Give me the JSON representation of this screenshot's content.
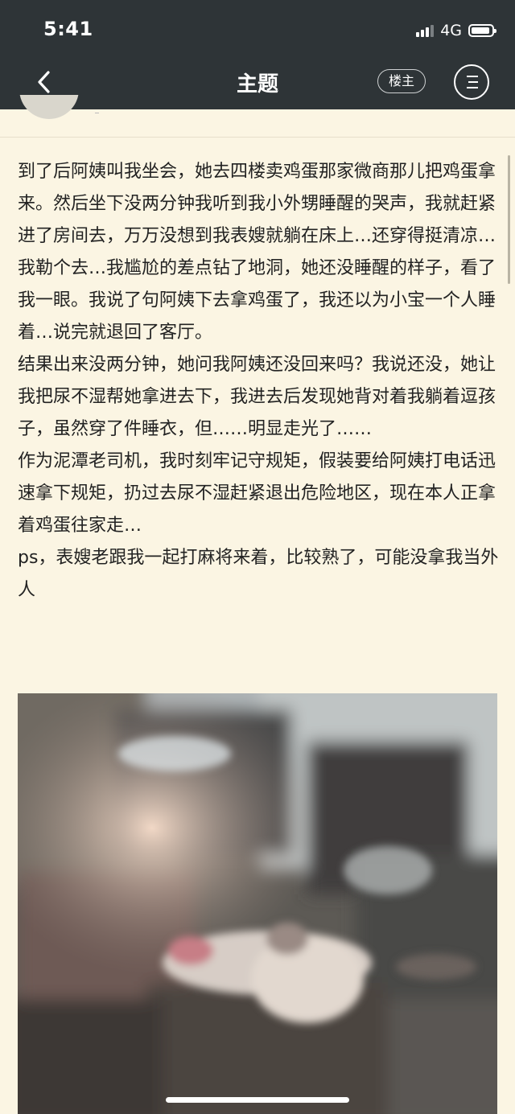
{
  "status_bar": {
    "time": "5:41",
    "network": "4G"
  },
  "header": {
    "title": "主题",
    "owner_button": "楼主"
  },
  "post": {
    "paragraphs": [
      "到了后阿姨叫我坐会，她去四楼卖鸡蛋那家微商那儿把鸡蛋拿来。然后坐下没两分钟我听到我小外甥睡醒的哭声，我就赶紧进了房间去，万万没想到我表嫂就躺在床上…还穿得挺清凉…",
      "我勒个去…我尴尬的差点钻了地洞，她还没睡醒的样子，看了我一眼。我说了句阿姨下去拿鸡蛋了，我还以为小宝一个人睡着…说完就退回了客厅。",
      "结果出来没两分钟，她问我阿姨还没回来吗？我说还没，她让我把尿不湿帮她拿进去下，我进去后发现她背对着我躺着逗孩子，虽然穿了件睡衣，但……明显走光了……",
      "作为泥潭老司机，我时刻牢记守规矩，假装要给阿姨打电话迅速拿下规矩，扔过去尿不湿赶紧退出危险地区，现在本人正拿着鸡蛋往家走…",
      "ps，表嫂老跟我一起打麻将来着，比较熟了，可能没拿我当外人"
    ]
  },
  "icons": {
    "back": "chevron-left-icon",
    "menu": "menu-icon",
    "signal": "signal-icon",
    "battery": "battery-icon"
  },
  "colors": {
    "header_bg": "#2e3437",
    "page_bg": "#fbf5e3",
    "text": "#222222"
  }
}
